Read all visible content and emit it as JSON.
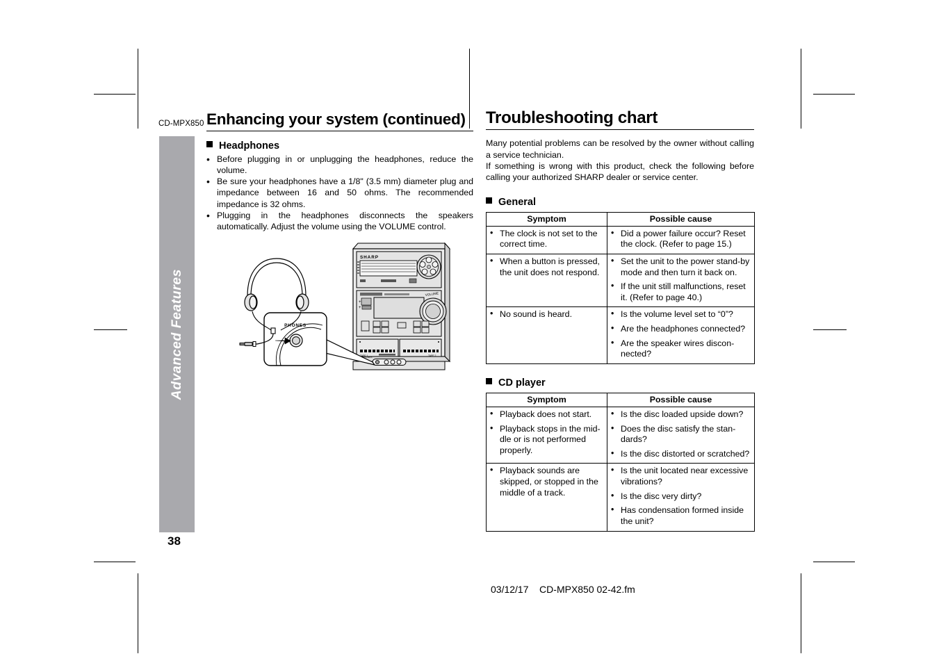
{
  "page": {
    "model_code": "CD-MPX850",
    "page_number": "38",
    "sidebar_tab_label": "Advanced Features",
    "sidebar_tab_color": "#a9a9ad",
    "footer": "03/12/17    CD-MPX850 02-42.fm"
  },
  "left": {
    "title": "Enhancing your system (continued)",
    "subsection": {
      "heading": "Headphones",
      "bullets": [
        "Before plugging in or unplugging the headphones, reduce the volume.",
        "Be sure your headphones have a 1/8\" (3.5 mm) diameter plug and impedance between 16 and 50 ohms. The recommended impedance is 32 ohms.",
        "Plugging in the headphones disconnects the speakers automatically. Adjust the volume using the VOLUME control."
      ]
    },
    "illustration": {
      "brand_label": "SHARP",
      "jack_callout_label": "PHONES",
      "alt": "Headphones being plugged into the PHONES jack on the front of the mini component system"
    }
  },
  "right": {
    "title": "Troubleshooting chart",
    "intro": [
      "Many potential problems can be resolved by the owner without calling a service technician.",
      "If something is wrong with this product, check the following before calling your authorized SHARP dealer or service center."
    ],
    "tables": [
      {
        "heading": "General",
        "columns": [
          "Symptom",
          "Possible cause"
        ],
        "rows": [
          {
            "symptom": [
              "The clock is not set to the correct time."
            ],
            "cause": [
              "Did a power failure occur? Reset the clock. (Refer to page 15.)"
            ]
          },
          {
            "symptom": [
              "When a button is pressed, the unit does not respond."
            ],
            "cause": [
              "Set the unit to the power stand-by mode and then turn it back on.",
              "If the unit still malfunctions, reset it. (Refer to page 40.)"
            ]
          },
          {
            "symptom": [
              "No sound is heard."
            ],
            "cause": [
              "Is the volume level set to “0”?",
              "Are the headphones connected?",
              "Are the speaker wires discon-nected?"
            ]
          }
        ]
      },
      {
        "heading": "CD player",
        "columns": [
          "Symptom",
          "Possible cause"
        ],
        "rows": [
          {
            "symptom": [
              "Playback does not start.",
              "Playback stops in the mid-dle or is not performed properly."
            ],
            "cause": [
              "Is the disc loaded upside down?",
              "Does the disc satisfy the stan-dards?",
              "Is the disc distorted or scratched?"
            ]
          },
          {
            "symptom": [
              "Playback sounds are skipped, or stopped in the middle of a track."
            ],
            "cause": [
              "Is the unit located near excessive vibrations?",
              "Is the disc very dirty?",
              "Has condensation formed inside the unit?"
            ]
          }
        ]
      }
    ]
  }
}
